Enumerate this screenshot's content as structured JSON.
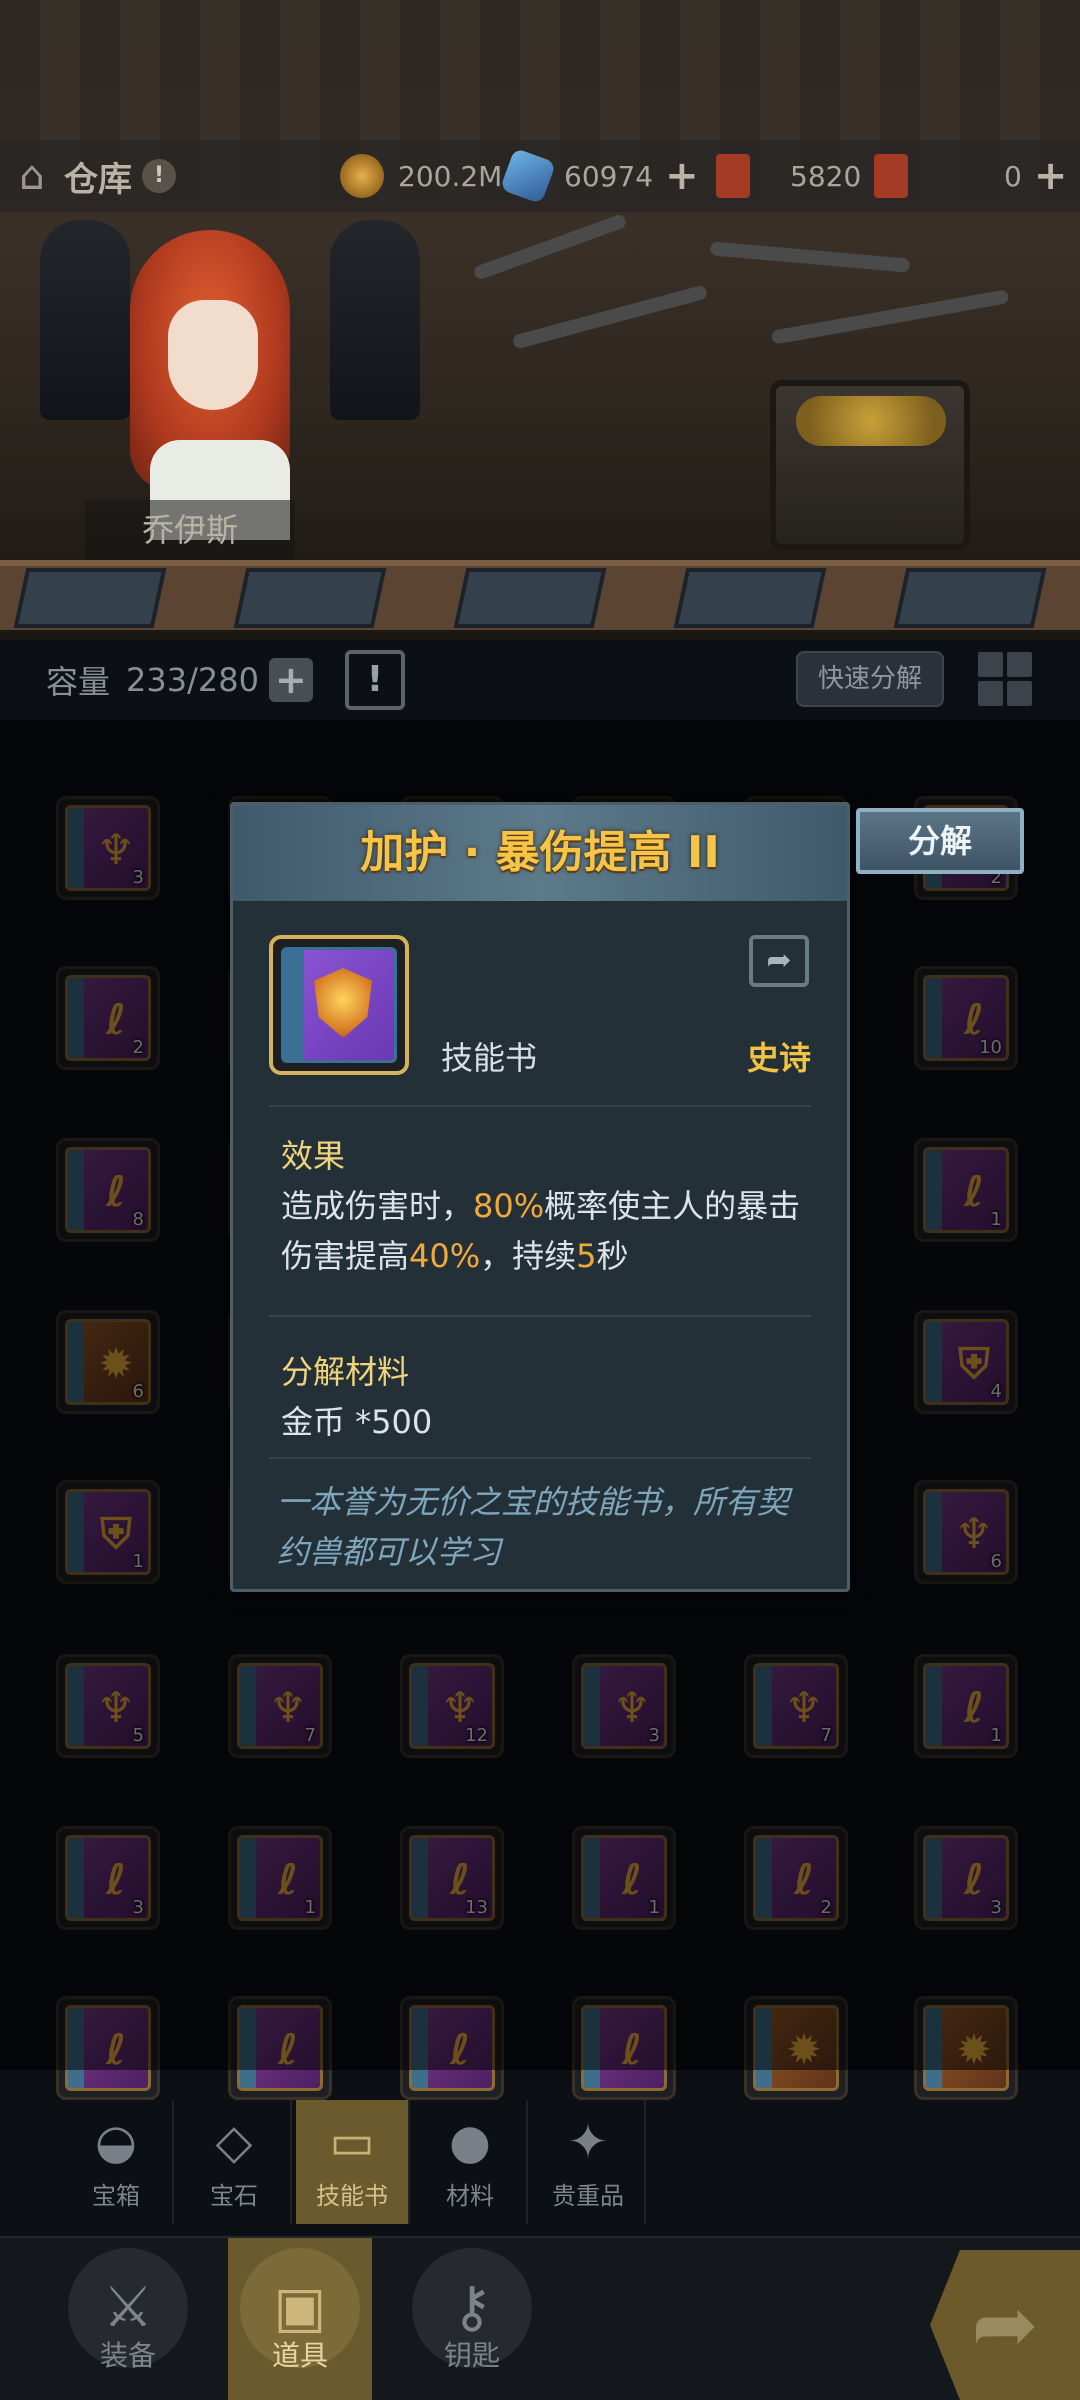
{
  "topbar": {
    "title": "仓库",
    "alert": "!",
    "resources": [
      {
        "icon": "gold-coin-icon",
        "value": "200.2M",
        "has_plus": false
      },
      {
        "icon": "crystal-icon",
        "value": "60974",
        "has_plus": true
      },
      {
        "icon": "ticket-icon",
        "value": "5820",
        "has_plus": false
      },
      {
        "icon": "ticket2-icon",
        "value": "0",
        "has_plus": true
      }
    ]
  },
  "character": {
    "name": "乔伊斯"
  },
  "capacity": {
    "label": "容量",
    "value": "233/280",
    "plus": "+"
  },
  "quick_decompose": "快速分解",
  "popup": {
    "title": "加护 · 暴伤提高 II",
    "item_type": "技能书",
    "rarity": "史诗",
    "effect_title": "效果",
    "effect_parts": {
      "a": "造成伤害时，",
      "b": "80%",
      "c": "概率使主人的暴击伤害提高",
      "d": "40%",
      "e": "，持续",
      "f": "5",
      "g": "秒"
    },
    "material_title": "分解材料",
    "material_text": "金币 *500",
    "flavor": "一本誉为无价之宝的技能书，所有契约兽都可以学习",
    "decompose_label": "分解"
  },
  "inventory": {
    "rows": [
      [
        {
          "c": "3",
          "t": "purple",
          "s": "♆"
        },
        {
          "c": "",
          "t": "purple",
          "s": ""
        },
        {
          "c": "",
          "t": "purple",
          "s": ""
        },
        {
          "c": "",
          "t": "purple",
          "s": ""
        },
        {
          "c": "",
          "t": "purple",
          "s": ""
        },
        {
          "c": "2",
          "t": "purple",
          "s": "ℓ"
        }
      ],
      [
        {
          "c": "2",
          "t": "purple",
          "s": "ℓ"
        },
        {
          "c": "",
          "t": "purple",
          "s": ""
        },
        {
          "c": "",
          "t": "purple",
          "s": ""
        },
        {
          "c": "",
          "t": "purple",
          "s": ""
        },
        {
          "c": "",
          "t": "purple",
          "s": ""
        },
        {
          "c": "10",
          "t": "purple",
          "s": "ℓ"
        }
      ],
      [
        {
          "c": "8",
          "t": "purple",
          "s": "ℓ"
        },
        {
          "c": "",
          "t": "purple",
          "s": ""
        },
        {
          "c": "",
          "t": "purple",
          "s": ""
        },
        {
          "c": "",
          "t": "purple",
          "s": ""
        },
        {
          "c": "",
          "t": "purple",
          "s": ""
        },
        {
          "c": "1",
          "t": "purple",
          "s": "ℓ"
        }
      ],
      [
        {
          "c": "6",
          "t": "orange",
          "s": "✹"
        },
        {
          "c": "",
          "t": "purple",
          "s": ""
        },
        {
          "c": "",
          "t": "purple",
          "s": ""
        },
        {
          "c": "",
          "t": "purple",
          "s": ""
        },
        {
          "c": "",
          "t": "purple",
          "s": ""
        },
        {
          "c": "4",
          "t": "purple",
          "s": "⛨"
        }
      ],
      [
        {
          "c": "1",
          "t": "purple",
          "s": "⛨"
        },
        {
          "c": "",
          "t": "purple",
          "s": ""
        },
        {
          "c": "",
          "t": "purple",
          "s": ""
        },
        {
          "c": "",
          "t": "purple",
          "s": ""
        },
        {
          "c": "",
          "t": "purple",
          "s": ""
        },
        {
          "c": "6",
          "t": "purple",
          "s": "♆"
        }
      ],
      [
        {
          "c": "5",
          "t": "purple",
          "s": "♆"
        },
        {
          "c": "7",
          "t": "purple",
          "s": "♆"
        },
        {
          "c": "12",
          "t": "purple",
          "s": "♆"
        },
        {
          "c": "3",
          "t": "purple",
          "s": "♆"
        },
        {
          "c": "7",
          "t": "purple",
          "s": "♆"
        },
        {
          "c": "1",
          "t": "purple",
          "s": "ℓ"
        }
      ],
      [
        {
          "c": "3",
          "t": "purple",
          "s": "ℓ"
        },
        {
          "c": "1",
          "t": "purple",
          "s": "ℓ"
        },
        {
          "c": "13",
          "t": "purple",
          "s": "ℓ"
        },
        {
          "c": "1",
          "t": "purple",
          "s": "ℓ"
        },
        {
          "c": "2",
          "t": "purple",
          "s": "ℓ"
        },
        {
          "c": "3",
          "t": "purple",
          "s": "ℓ"
        }
      ],
      [
        {
          "c": "",
          "t": "purple",
          "s": "ℓ"
        },
        {
          "c": "",
          "t": "purple",
          "s": "ℓ"
        },
        {
          "c": "",
          "t": "purple",
          "s": "ℓ"
        },
        {
          "c": "",
          "t": "purple",
          "s": "ℓ"
        },
        {
          "c": "",
          "t": "orange",
          "s": "✹"
        },
        {
          "c": "",
          "t": "orange",
          "s": "✹"
        }
      ]
    ]
  },
  "subtabs": [
    {
      "label": "宝箱",
      "icon": "chest-icon",
      "active": false
    },
    {
      "label": "宝石",
      "icon": "gem-icon",
      "active": false
    },
    {
      "label": "技能书",
      "icon": "book-icon",
      "active": true
    },
    {
      "label": "材料",
      "icon": "material-icon",
      "active": false
    },
    {
      "label": "贵重品",
      "icon": "valuable-icon",
      "active": false
    }
  ],
  "bottomnav": [
    {
      "label": "装备",
      "icon": "equipment-icon",
      "active": false
    },
    {
      "label": "道具",
      "icon": "items-icon",
      "active": true
    },
    {
      "label": "钥匙",
      "icon": "key-icon",
      "active": false
    }
  ],
  "colors": {
    "title_gold": "#f6c547",
    "highlight_orange": "#f2a93a",
    "flavor_blue": "#7ea6bd",
    "active_tab": "#6a5a2e"
  }
}
